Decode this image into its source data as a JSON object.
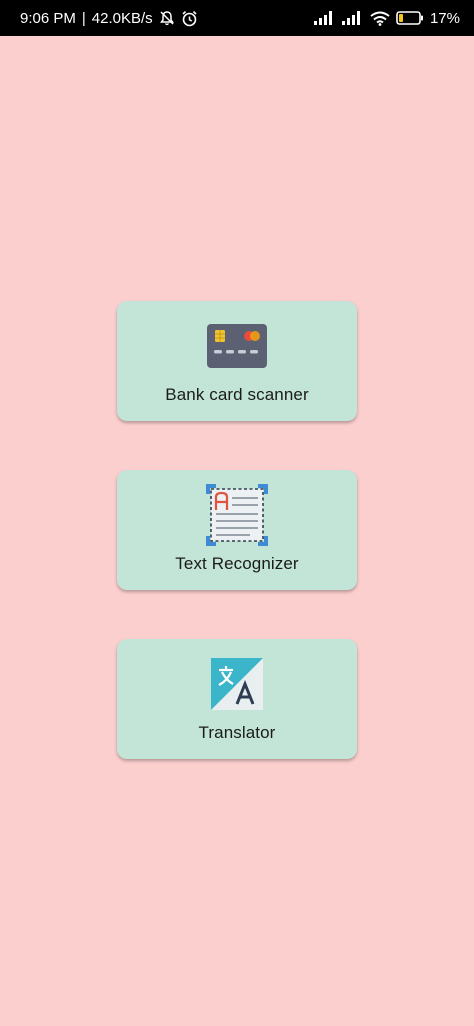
{
  "status_bar": {
    "time": "9:06 PM",
    "speed": "42.0KB/s",
    "battery_percent": "17%",
    "icons": [
      "mute-bell-icon",
      "alarm-icon",
      "signal-icon",
      "signal-icon",
      "wifi-icon",
      "battery-icon"
    ]
  },
  "menu": {
    "items": [
      {
        "label": "Bank card scanner",
        "icon": "bank-card-icon"
      },
      {
        "label": "Text Recognizer",
        "icon": "text-recognition-icon"
      },
      {
        "label": "Translator",
        "icon": "translate-icon"
      }
    ]
  },
  "colors": {
    "background": "#fccfcf",
    "card": "#c3e5d7",
    "status_bar": "#000000"
  }
}
